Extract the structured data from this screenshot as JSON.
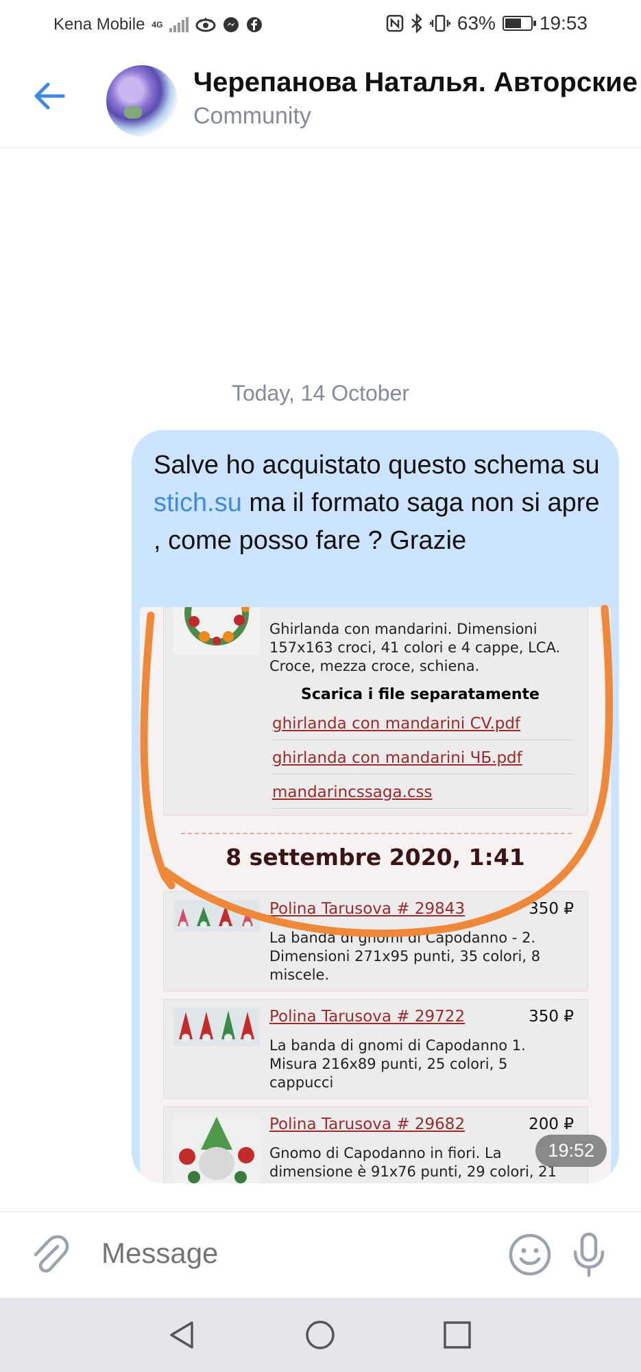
{
  "status_bar": {
    "carrier": "Kena Mobile",
    "network": "4G",
    "battery": "63%",
    "battery_level": 0.63,
    "time": "19:53"
  },
  "header": {
    "title": "Черепанова Наталья. Авторские",
    "subtitle": "Community"
  },
  "chat": {
    "date_separator": "Today, 14 October",
    "message": {
      "text_before": "Salve ho acquistato questo schema su ",
      "link_text": "stich.su",
      "text_after": " ma il formato saga non si apre , come posso fare ? Grazie",
      "time": "19:52"
    },
    "attachment": {
      "item1_description": "Ghirlanda con mandarini. Dimensioni 157x163 croci, 41 colori e 4 cappe, LCA. Croce, mezza croce, schiena.",
      "downloads_heading": "Scarica i file separatamente",
      "files": [
        "ghirlanda con mandarini CV.pdf",
        "ghirlanda con mandarini ЧБ.pdf",
        "mandarincssaga.css"
      ],
      "section_date": "8 settembre 2020, 1:41",
      "items": [
        {
          "title": "Polina Tarusova # 29843",
          "price": "350 ₽",
          "description": "La banda di gnomi di Capodanno - 2. Dimensioni 271x95 punti, 35 colori, 8 miscele."
        },
        {
          "title": "Polina Tarusova # 29722",
          "price": "350 ₽",
          "description": "La banda di gnomi di Capodanno 1. Misura 216x89 punti, 25 colori, 5 cappucci"
        },
        {
          "title": "Polina Tarusova # 29682",
          "price": "200 ₽",
          "description": "Gnomo di Capodanno in fiori. La dimensione è 91x76 punti, 29 colori, 21"
        }
      ]
    }
  },
  "composer": {
    "placeholder": "Message"
  },
  "icons": {
    "back": "arrow-left-icon",
    "attach": "paperclip-icon",
    "emoji": "smile-icon",
    "mic": "microphone-icon",
    "nav_back": "triangle-back-icon",
    "nav_home": "circle-home-icon",
    "nav_recents": "square-recents-icon"
  },
  "colors": {
    "accent": "#3f8ae0",
    "bubble": "#cce4ff",
    "annotation": "#f0883a",
    "link_in_shot": "#9b2b2b"
  }
}
